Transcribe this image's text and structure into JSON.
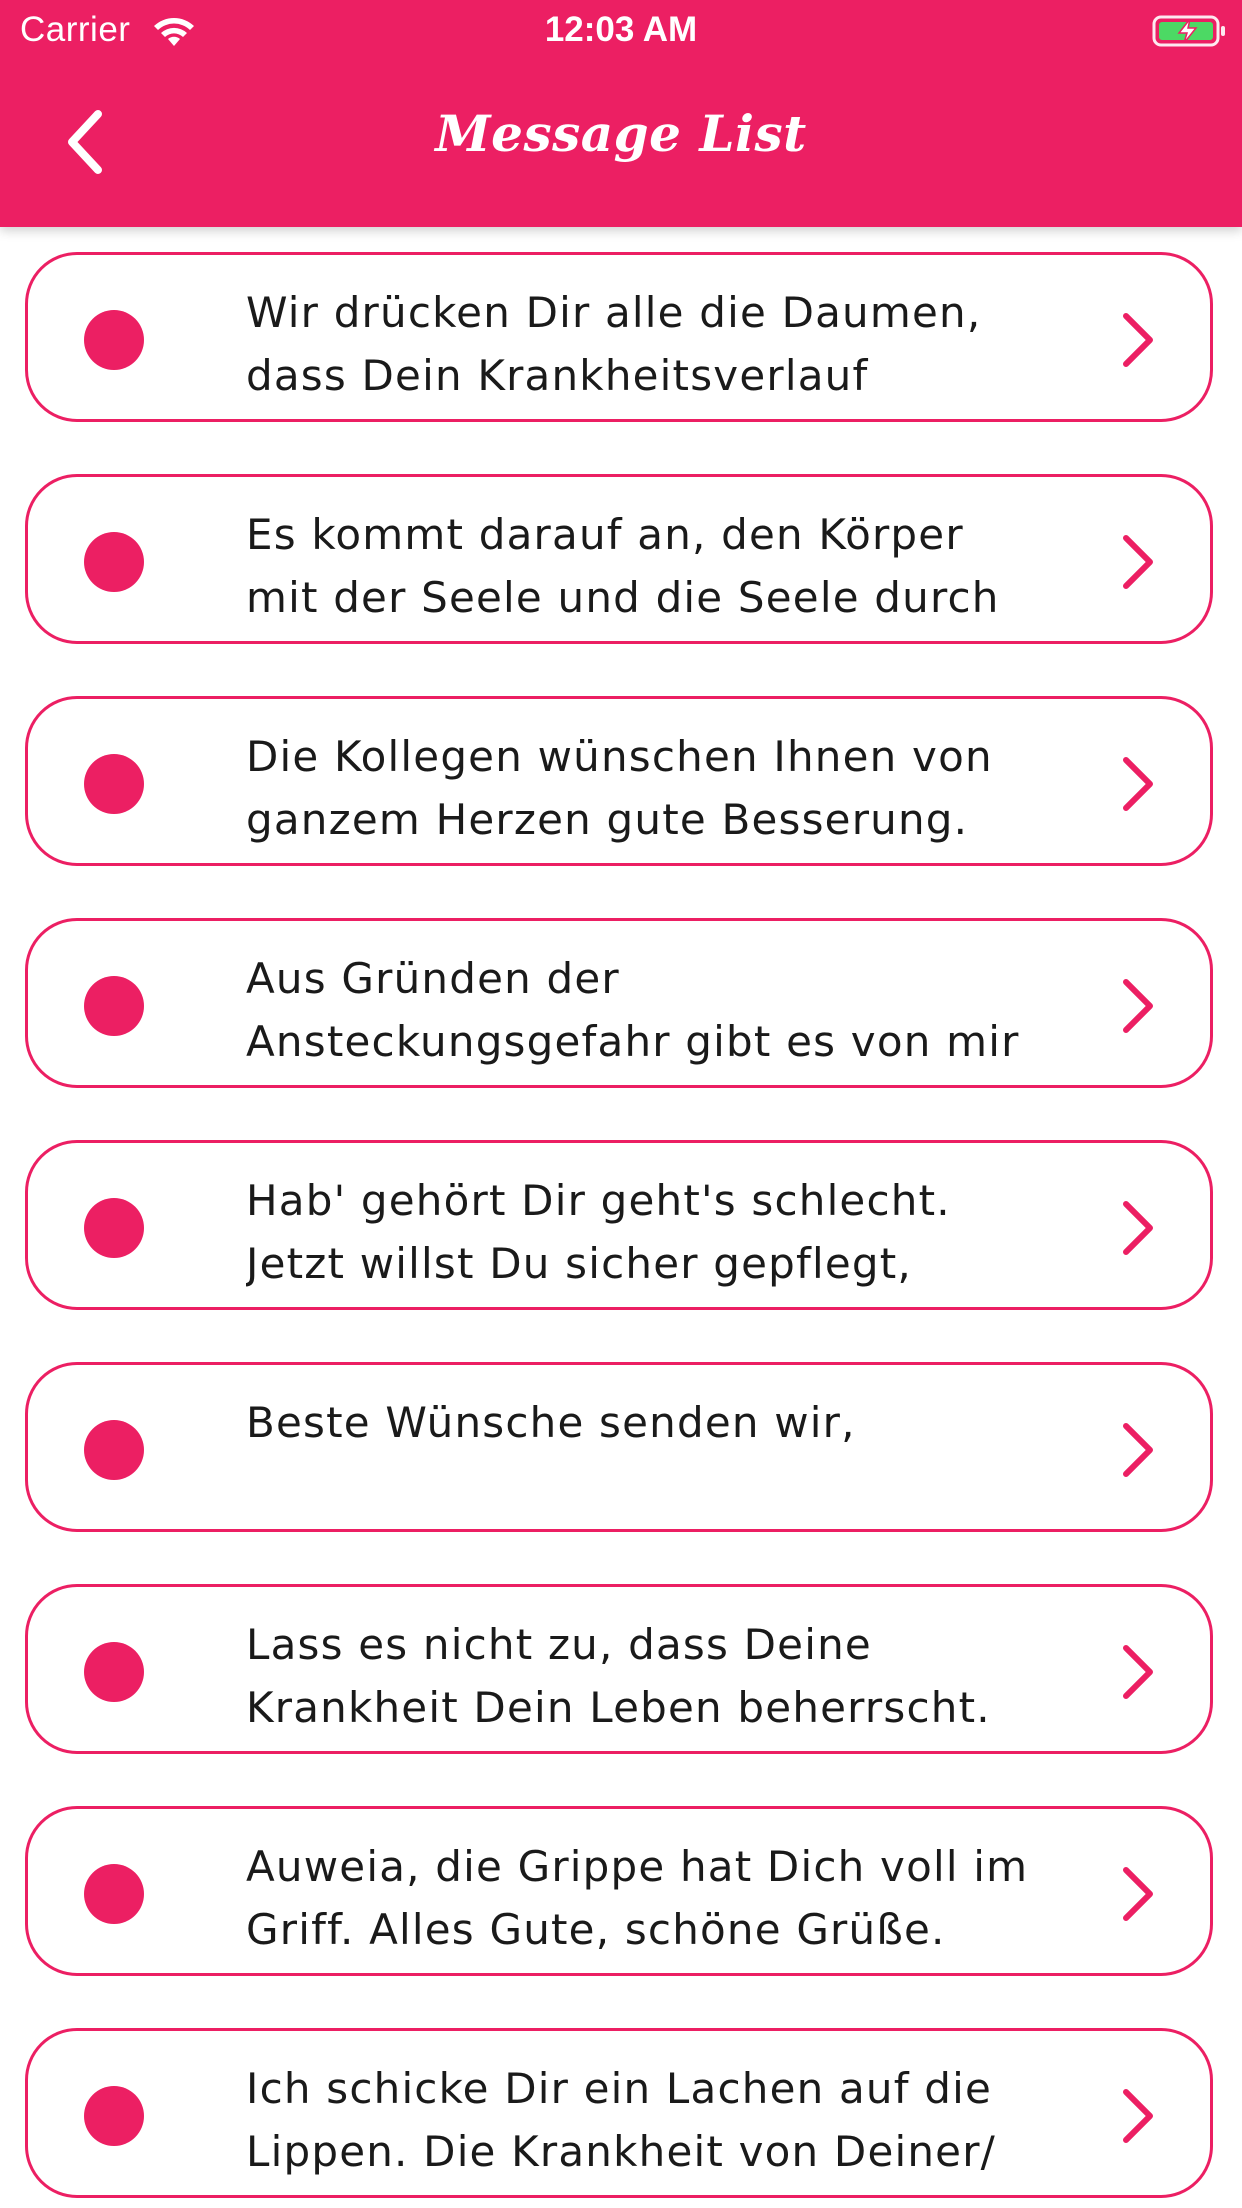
{
  "status_bar": {
    "carrier": "Carrier",
    "time": "12:03 AM"
  },
  "nav": {
    "title": "Message List",
    "back_icon": "chevron-left-icon"
  },
  "colors": {
    "accent": "#EC1F63",
    "text": "#1a1a1a",
    "battery": "#4CD964"
  },
  "messages": [
    {
      "text": "Wir drücken Dir alle die Daumen,\ndass Dein Krankheitsverlauf"
    },
    {
      "text": "Es kommt darauf an, den Körper\nmit der Seele und die Seele durch"
    },
    {
      "text": "Die Kollegen wünschen Ihnen von\nganzem Herzen gute Besserung."
    },
    {
      "text": "Aus Gründen der\nAnsteckungsgefahr gibt es von mir"
    },
    {
      "text": "Hab' gehört Dir geht's schlecht.\nJetzt willst Du sicher gepflegt,"
    },
    {
      "text": "Beste Wünsche senden wir,"
    },
    {
      "text": "Lass es nicht zu, dass Deine\nKrankheit Dein Leben beherrscht."
    },
    {
      "text": "Auweia, die Grippe hat Dich voll im\nGriff. Alles Gute, schöne Grüße."
    },
    {
      "text": "Ich schicke Dir ein Lachen auf die\nLippen. Die Krankheit von Deiner/"
    }
  ]
}
